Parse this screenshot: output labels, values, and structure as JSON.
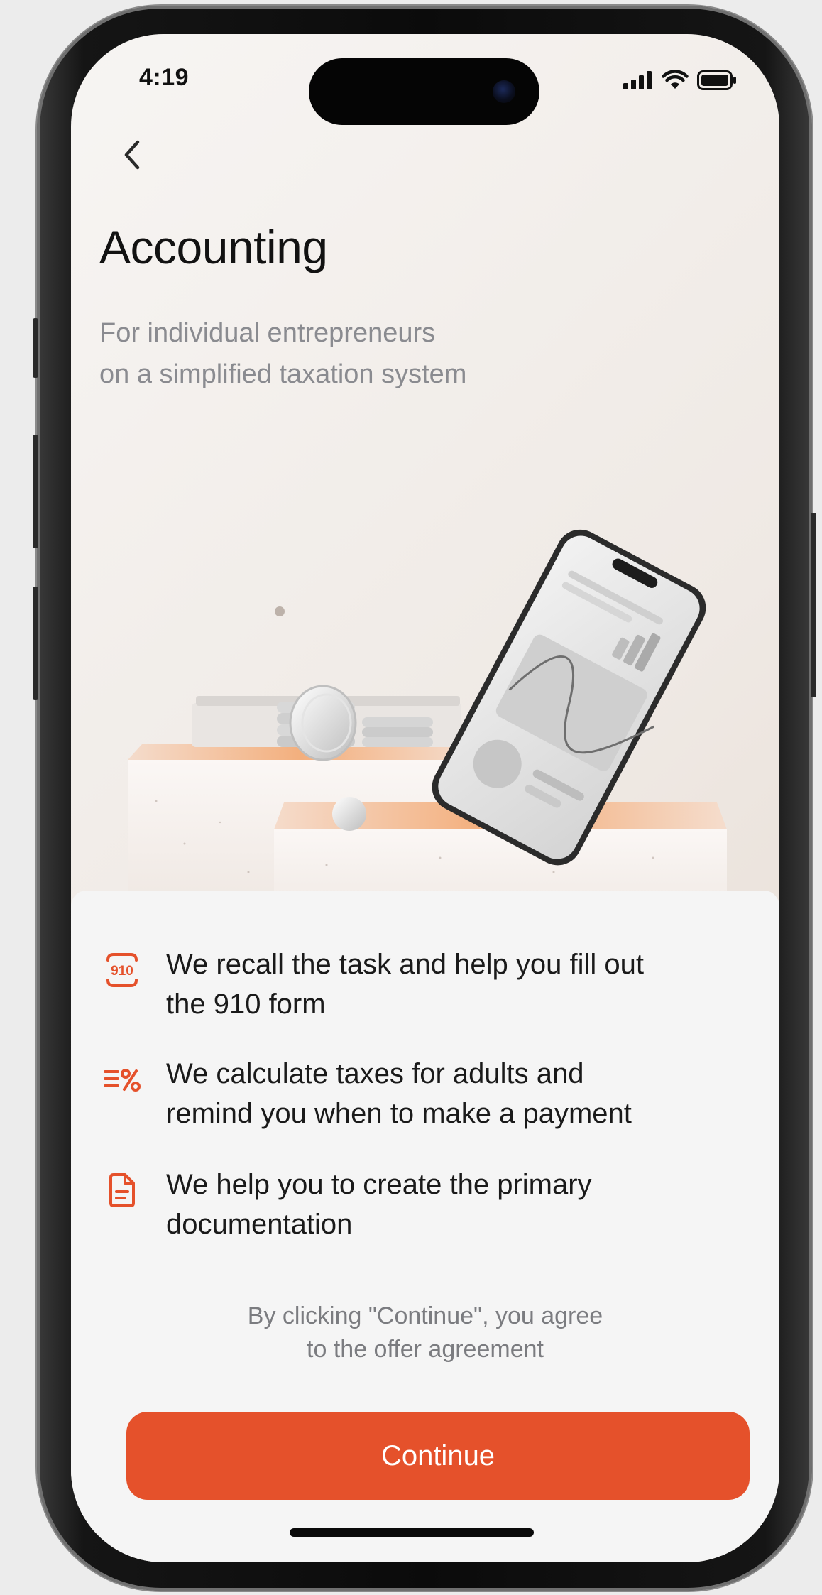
{
  "status_bar": {
    "time": "4:19"
  },
  "header": {
    "back_icon": "chevron-left-icon",
    "title": "Accounting",
    "subtitle_line1": "For individual entrepreneurs",
    "subtitle_line2": "on a simplified taxation system"
  },
  "features": [
    {
      "icon": "form-910-icon",
      "line1": "We recall the task and help you fill out",
      "line2": "the 910 form"
    },
    {
      "icon": "percent-list-icon",
      "line1": "We calculate taxes for adults and",
      "line2": "remind you when to make a payment"
    },
    {
      "icon": "document-icon",
      "line1": "We help you to create the primary",
      "line2": "documentation"
    }
  ],
  "legal": {
    "line1": "By clicking \"Continue\", you agree",
    "line2": "to the offer agreement"
  },
  "cta": {
    "label": "Continue"
  },
  "colors": {
    "accent": "#e5512b",
    "text": "#1a1a1a",
    "muted": "#8a8b90",
    "sheet": "#f5f5f5"
  }
}
